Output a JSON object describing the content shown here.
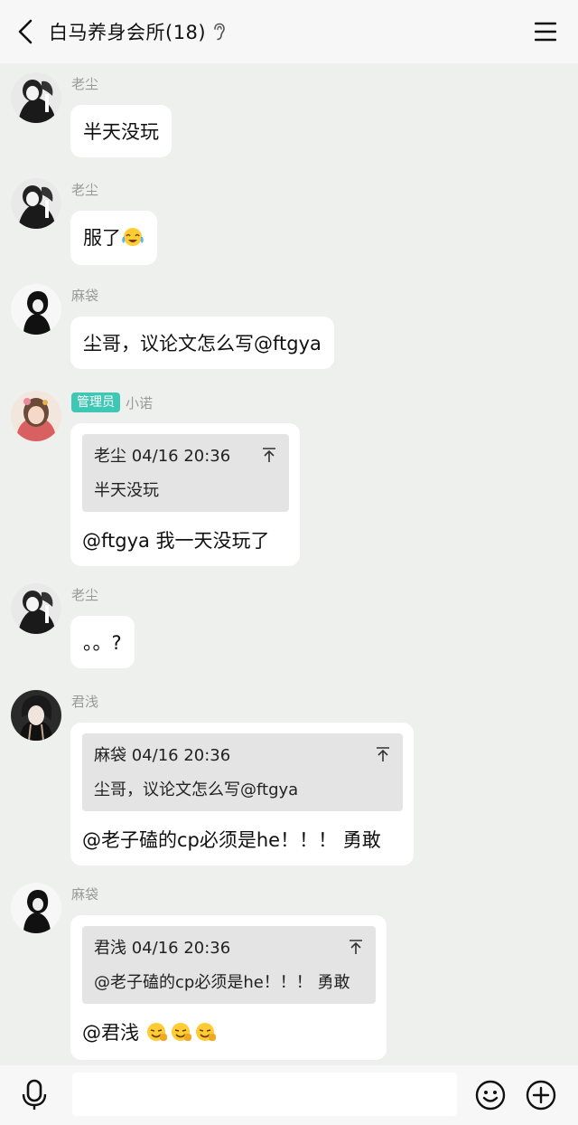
{
  "header": {
    "title": "白马养身会所(18)"
  },
  "messages": [
    {
      "sender": "老尘",
      "text": "半天没玩"
    },
    {
      "sender": "老尘",
      "text": "服了"
    },
    {
      "sender": "麻袋",
      "text": "尘哥，议论文怎么写@ftgya"
    },
    {
      "badge": "管理员",
      "sender": "小诺",
      "quote_meta": "老尘 04/16 20:36",
      "quote_text": "半天没玩",
      "text": "@ftgya 我一天没玩了"
    },
    {
      "sender": "老尘",
      "text": "。。?"
    },
    {
      "sender": "君浅",
      "quote_meta": "麻袋 04/16 20:36",
      "quote_text": "尘哥，议论文怎么写@ftgya",
      "text": "@老子磕的cp必须是he！！！ 勇敢"
    },
    {
      "sender": "麻袋",
      "quote_meta": "君浅 04/16 20:36",
      "quote_text": "@老子磕的cp必须是he！！！ 勇敢",
      "text": "@君浅 "
    }
  ],
  "input": {
    "placeholder": ""
  },
  "colors": {
    "background": "#eef0ee",
    "bubble": "#ffffff",
    "badge": "#3fc7b5",
    "quote": "#e4e4e4"
  },
  "icons": [
    "back-arrow-icon",
    "ear-icon",
    "menu-icon",
    "microphone-icon",
    "emoji-icon",
    "plus-icon",
    "crying-laughing-emoji",
    "thumbs-emoji"
  ]
}
